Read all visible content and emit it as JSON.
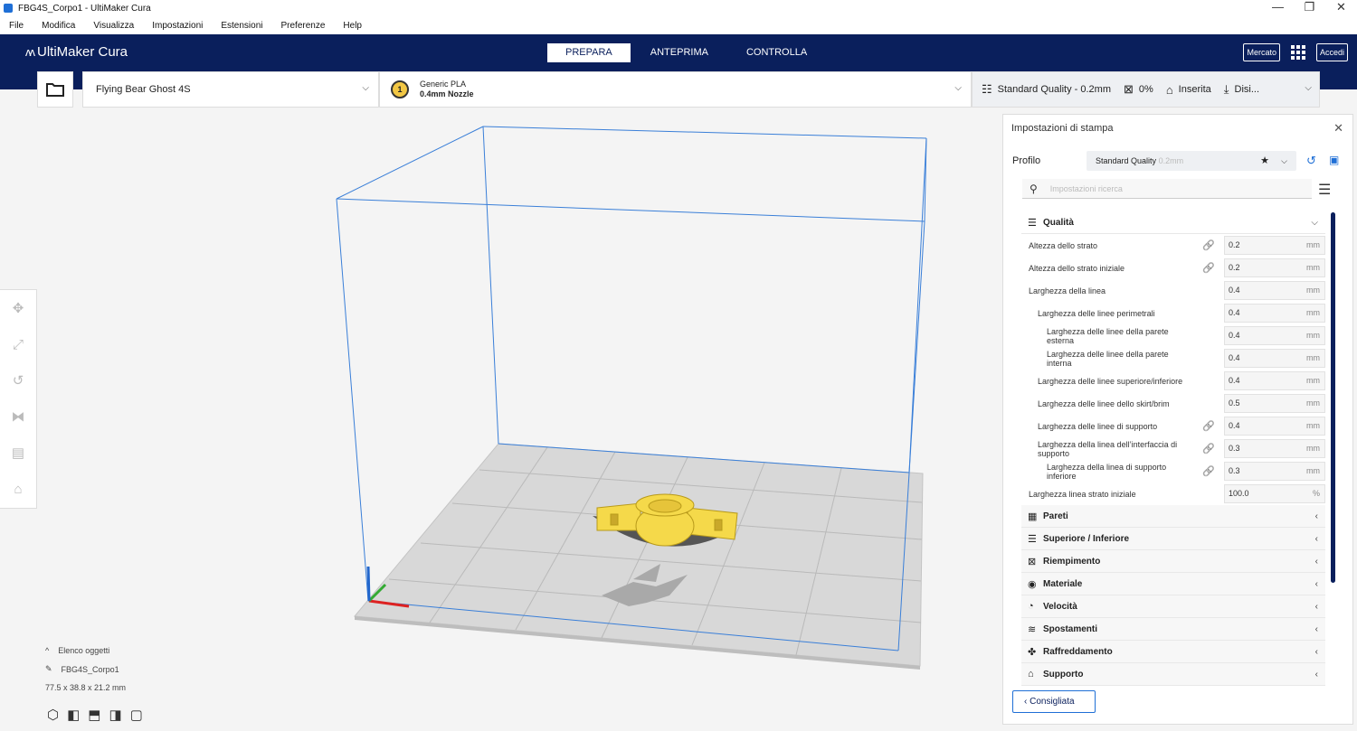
{
  "window": {
    "title": "FBG4S_Corpo1 - UltiMaker Cura",
    "controls": [
      "—",
      "❐",
      "✕"
    ]
  },
  "menu": [
    "File",
    "Modifica",
    "Visualizza",
    "Impostazioni",
    "Estensioni",
    "Preferenze",
    "Help"
  ],
  "header": {
    "logo": "UltiMaker Cura",
    "stages": [
      "PREPARA",
      "ANTEPRIMA",
      "CONTROLLA"
    ],
    "active_stage": "PREPARA",
    "marketplace": "Mercato",
    "signin": "Accedi"
  },
  "toolbar": {
    "printer": "Flying Bear Ghost 4S",
    "extruder_number": "1",
    "material": "Generic PLA",
    "nozzle": "0.4mm Nozzle",
    "quality": "Standard Quality - 0.2mm",
    "infill": "0%",
    "support": "Inserita",
    "adhesion": "Disi..."
  },
  "object_list": {
    "toggle_label": "Elenco oggetti",
    "object_name": "FBG4S_Corpo1",
    "dimensions": "77.5 x 38.8 x 21.2 mm"
  },
  "panel": {
    "title": "Impostazioni di stampa",
    "profile_label": "Profilo",
    "profile_value": "Standard Quality",
    "profile_sub": "0.2mm",
    "search_placeholder": "Impostazioni ricerca",
    "recommended_button": "Consigliata",
    "open_category": "Qualità",
    "settings": [
      {
        "label": "Altezza dello strato",
        "value": "0.2",
        "unit": "mm",
        "indent": 0,
        "link": true
      },
      {
        "label": "Altezza dello strato iniziale",
        "value": "0.2",
        "unit": "mm",
        "indent": 0,
        "link": true
      },
      {
        "label": "Larghezza della linea",
        "value": "0.4",
        "unit": "mm",
        "indent": 0,
        "link": false
      },
      {
        "label": "Larghezza delle linee perimetrali",
        "value": "0.4",
        "unit": "mm",
        "indent": 1,
        "link": false
      },
      {
        "label": "Larghezza delle linee della parete esterna",
        "value": "0.4",
        "unit": "mm",
        "indent": 2,
        "link": false
      },
      {
        "label": "Larghezza delle linee della parete interna",
        "value": "0.4",
        "unit": "mm",
        "indent": 2,
        "link": false
      },
      {
        "label": "Larghezza delle linee superiore/inferiore",
        "value": "0.4",
        "unit": "mm",
        "indent": 1,
        "link": false
      },
      {
        "label": "Larghezza delle linee dello skirt/brim",
        "value": "0.5",
        "unit": "mm",
        "indent": 1,
        "link": false
      },
      {
        "label": "Larghezza delle linee di supporto",
        "value": "0.4",
        "unit": "mm",
        "indent": 1,
        "link": true
      },
      {
        "label": "Larghezza della linea dell’interfaccia di supporto",
        "value": "0.3",
        "unit": "mm",
        "indent": 1,
        "link": true
      },
      {
        "label": "Larghezza della linea di supporto inferiore",
        "value": "0.3",
        "unit": "mm",
        "indent": 2,
        "link": true
      },
      {
        "label": "Larghezza linea strato iniziale",
        "value": "100.0",
        "unit": "%",
        "indent": 0,
        "link": false
      }
    ],
    "categories": [
      {
        "label": "Pareti",
        "icon": "walls-icon",
        "glyph": "▦"
      },
      {
        "label": "Superiore / Inferiore",
        "icon": "top-bottom-icon",
        "glyph": "☰"
      },
      {
        "label": "Riempimento",
        "icon": "infill-icon",
        "glyph": "⊠"
      },
      {
        "label": "Materiale",
        "icon": "material-icon",
        "glyph": "◉"
      },
      {
        "label": "Velocità",
        "icon": "speed-icon",
        "glyph": "◔"
      },
      {
        "label": "Spostamenti",
        "icon": "travel-icon",
        "glyph": "≋"
      },
      {
        "label": "Raffreddamento",
        "icon": "cooling-icon",
        "glyph": "✤"
      },
      {
        "label": "Supporto",
        "icon": "support-icon",
        "glyph": "⌂"
      }
    ]
  },
  "colors": {
    "header_bg": "#0a1f5c",
    "accent": "#1f6fd6",
    "model": "#f5d94a",
    "build_volume": "#3a7fd8"
  }
}
